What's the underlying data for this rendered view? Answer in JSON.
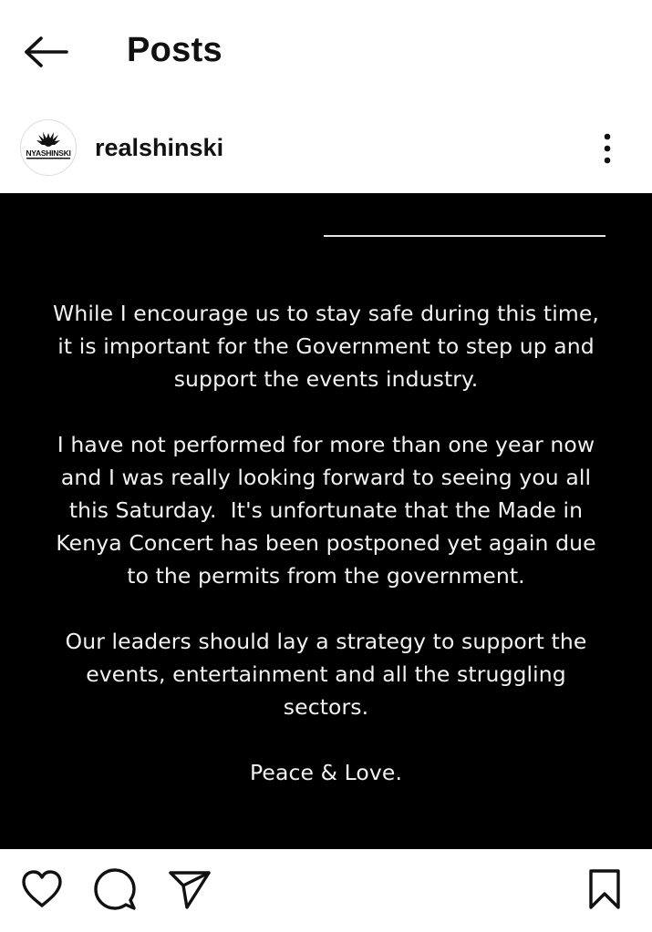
{
  "header": {
    "title": "Posts",
    "back_icon": "arrow-left-icon"
  },
  "post": {
    "username": "realshinski",
    "avatar_text": "NYASHINSKI",
    "more_icon": "more-vertical-icon",
    "image_paragraphs": [
      [
        "While I encourage us to stay safe during this time,",
        "it is important for the Government to step up and",
        "support the events industry."
      ],
      [
        "I have not performed for more than one year now",
        "and I was really looking forward to seeing you all",
        "this Saturday.  It's unfortunate that the Made in",
        "Kenya Concert has been postponed yet again due",
        "to the permits from the government."
      ],
      [
        "Our leaders should lay a strategy to support the",
        "events, entertainment and all the struggling",
        "sectors."
      ],
      [
        "Peace & Love."
      ]
    ]
  },
  "actions": {
    "like_icon": "heart-icon",
    "comment_icon": "comment-icon",
    "share_icon": "send-icon",
    "save_icon": "bookmark-icon"
  },
  "colors": {
    "background": "#ffffff",
    "post_background": "#000000",
    "post_text": "#f2f2f2",
    "text": "#111111"
  }
}
